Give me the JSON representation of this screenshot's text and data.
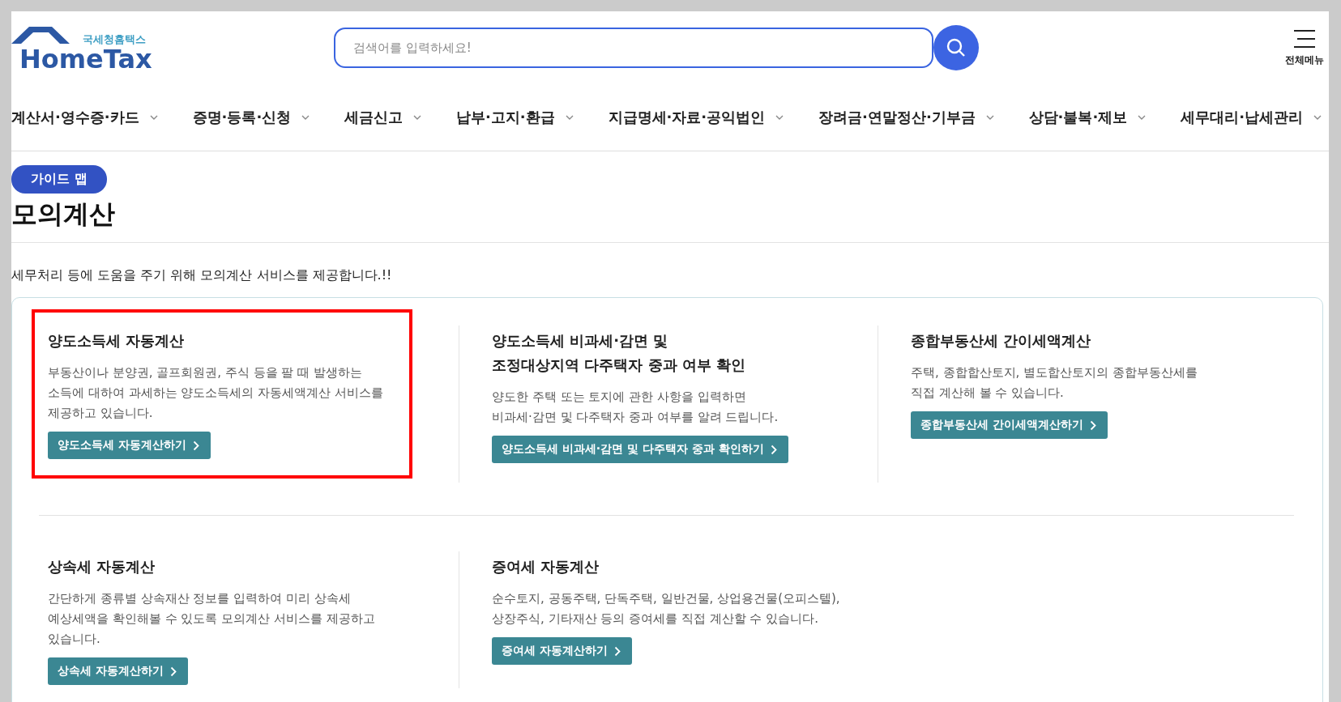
{
  "header": {
    "logo": {
      "subtitle": "국세청홈택스",
      "name": "HomeTax"
    },
    "search": {
      "placeholder": "검색어를 입력하세요!"
    },
    "menu_label": "전체메뉴"
  },
  "nav": [
    "계산서·영수증·카드",
    "증명·등록·신청",
    "세금신고",
    "납부·고지·환급",
    "지급명세·자료·공익법인",
    "장려금·연말정산·기부금",
    "상담·불복·제보",
    "세무대리·납세관리"
  ],
  "badge": "가이드 맵",
  "page_title": "모의계산",
  "intro": "세무처리 등에 도움을 주기 위해 모의계산 서비스를 제공합니다.!!",
  "rows": [
    {
      "items": [
        {
          "title_lines": [
            "양도소득세 자동계산"
          ],
          "description_lines": [
            "부동산이나 분양권, 골프회원권, 주식 등을 팔 때 발생하는",
            "소득에 대하여 과세하는 양도소득세의 자동세액계산 서비스를",
            "제공하고 있습니다."
          ],
          "button": "양도소득세 자동계산하기",
          "highlighted": true
        },
        {
          "title_lines": [
            "양도소득세 비과세·감면 및",
            "조정대상지역 다주택자 중과 여부 확인"
          ],
          "description_lines": [
            "양도한 주택 또는 토지에 관한 사항을 입력하면",
            "비과세·감면 및 다주택자 중과 여부를 알려 드립니다."
          ],
          "button": "양도소득세 비과세·감면 및 다주택자 중과 확인하기",
          "highlighted": false
        },
        {
          "title_lines": [
            "종합부동산세 간이세액계산"
          ],
          "description_lines": [
            "주택, 종합합산토지, 별도합산토지의 종합부동산세를",
            "직접 계산해 볼 수 있습니다."
          ],
          "button": "종합부동산세 간이세액계산하기",
          "highlighted": false
        }
      ]
    },
    {
      "items": [
        {
          "title_lines": [
            "상속세 자동계산"
          ],
          "description_lines": [
            "간단하게 종류별 상속재산 정보를 입력하여 미리 상속세",
            "예상세액을 확인해볼 수 있도록 모의계산 서비스를 제공하고",
            "있습니다."
          ],
          "button": "상속세 자동계산하기",
          "highlighted": false
        },
        {
          "title_lines": [
            "증여세 자동계산"
          ],
          "description_lines": [
            "순수토지, 공동주택, 단독주택, 일반건물, 상업용건물(오피스텔),",
            "상장주식, 기타재산 등의 증여세를 직접 계산할 수 있습니다."
          ],
          "button": "증여세 자동계산하기",
          "highlighted": false
        }
      ]
    }
  ]
}
